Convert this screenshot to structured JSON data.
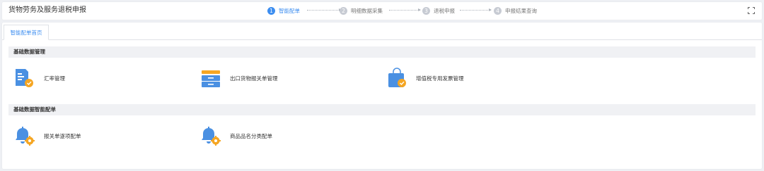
{
  "header": {
    "title": "货物劳务及服务退税申报",
    "steps": [
      {
        "num": "1",
        "label": "智能配单",
        "active": true
      },
      {
        "num": "2",
        "label": "明细数据采集",
        "active": false
      },
      {
        "num": "3",
        "label": "退税申报",
        "active": false
      },
      {
        "num": "4",
        "label": "申报结果查询",
        "active": false
      }
    ]
  },
  "tabs": [
    {
      "label": "智能配单首页",
      "active": true
    }
  ],
  "sections": [
    {
      "title": "基础数据管理",
      "items": [
        {
          "label": "汇率管理",
          "icon": "exchange-rate-document-icon"
        },
        {
          "label": "出口货物报关单管理",
          "icon": "cabinet-drawer-icon"
        },
        {
          "label": "增值税专用发票管理",
          "icon": "shopping-bag-check-icon"
        }
      ]
    },
    {
      "title": "基础数据智能配单",
      "items": [
        {
          "label": "报关单逐项配单",
          "icon": "bell-gear-icon"
        },
        {
          "label": "商品品名分类配单",
          "icon": "bell-gear-icon"
        }
      ]
    }
  ],
  "colors": {
    "accent": "#3d8ef0",
    "icon_blue": "#4a90e2",
    "icon_orange": "#f5a623",
    "section_bg": "#f0f1f4",
    "page_bg": "#eef0f4"
  }
}
